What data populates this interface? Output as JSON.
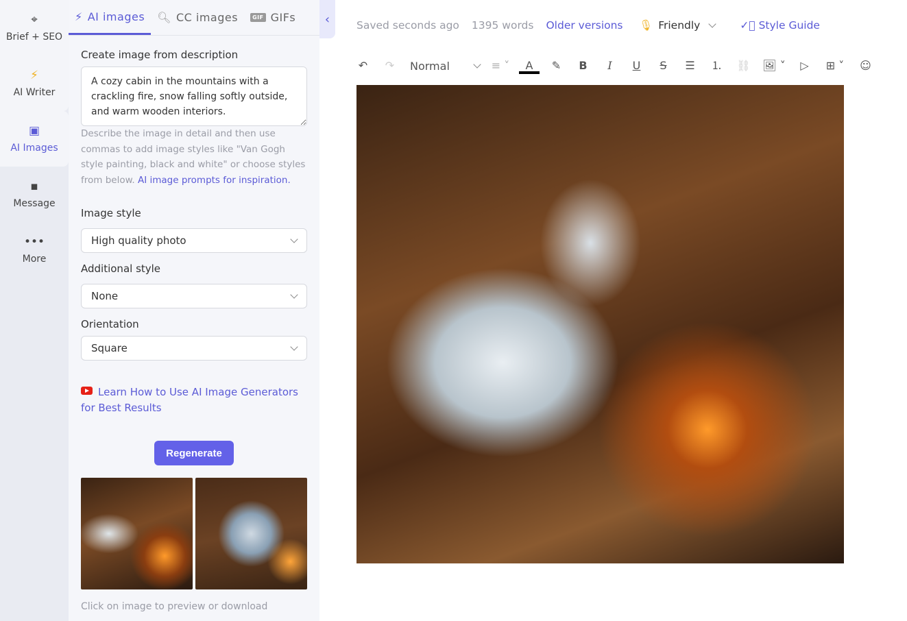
{
  "rail": [
    {
      "label": "Brief + SEO",
      "icon": "crosshair-icon"
    },
    {
      "label": "AI Writer",
      "icon": "lightning-icon"
    },
    {
      "label": "AI Images",
      "icon": "image-icon"
    },
    {
      "label": "Message",
      "icon": "message-icon"
    },
    {
      "label": "More",
      "icon": "more-icon"
    }
  ],
  "tabs": [
    {
      "label": "AI images",
      "icon": "lightning-icon"
    },
    {
      "label": "CC images",
      "icon": "search-icon"
    },
    {
      "label": "GIFs",
      "icon": "gif-icon",
      "badge": "GIF"
    }
  ],
  "panel": {
    "desc_label": "Create image from description",
    "desc_value": "A cozy cabin in the mountains with a crackling fire, snow falling softly outside, and warm wooden interiors.",
    "help": "Describe the image in detail and then use commas to add image styles like \"Van Gogh style painting, black and white\" or choose styles from below. ",
    "help_link": "AI image prompts for inspiration.",
    "style_label": "Image style",
    "style_value": "High quality photo",
    "add_label": "Additional style",
    "add_value": "None",
    "orient_label": "Orientation",
    "orient_value": "Square",
    "learn_link": "Learn How to Use AI Image Generators for Best Results",
    "regenerate": "Regenerate",
    "footer": "Click on image to preview or download"
  },
  "topbar": {
    "saved": "Saved seconds ago",
    "words": "1395 words",
    "older": "Older versions",
    "tone": "Friendly",
    "style_guide": "Style Guide"
  },
  "toolbar": {
    "format": "Normal"
  },
  "colors": {
    "accent": "#5b5bd6",
    "button": "#6361e8"
  }
}
